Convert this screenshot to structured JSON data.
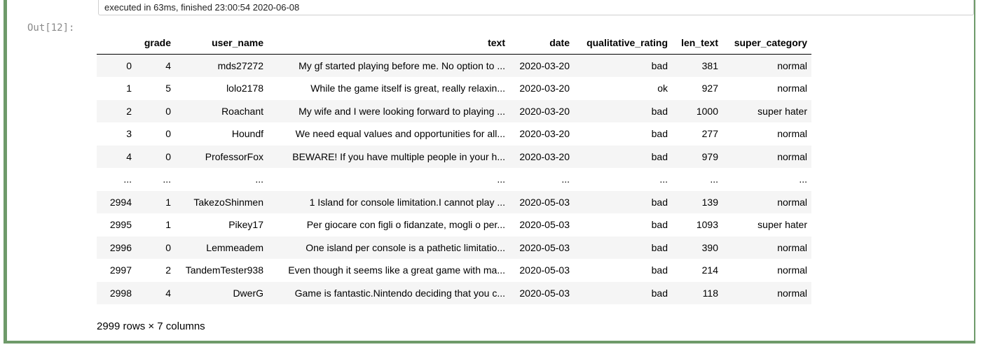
{
  "exec_status": "executed in 63ms, finished 23:00:54 2020-06-08",
  "out_prompt": "Out[12]:",
  "table": {
    "columns": [
      "grade",
      "user_name",
      "text",
      "date",
      "qualitative_rating",
      "len_text",
      "super_category"
    ],
    "rows": [
      [
        "0",
        "4",
        "mds27272",
        "My gf started playing before me. No option to ...",
        "2020-03-20",
        "bad",
        "381",
        "normal"
      ],
      [
        "1",
        "5",
        "lolo2178",
        "While the game itself is great, really relaxin...",
        "2020-03-20",
        "ok",
        "927",
        "normal"
      ],
      [
        "2",
        "0",
        "Roachant",
        "My wife and I were looking forward to playing ...",
        "2020-03-20",
        "bad",
        "1000",
        "super hater"
      ],
      [
        "3",
        "0",
        "Houndf",
        "We need equal values and opportunities for all...",
        "2020-03-20",
        "bad",
        "277",
        "normal"
      ],
      [
        "4",
        "0",
        "ProfessorFox",
        "BEWARE! If you have multiple people in your h...",
        "2020-03-20",
        "bad",
        "979",
        "normal"
      ],
      [
        "...",
        "...",
        "...",
        "...",
        "...",
        "...",
        "...",
        "..."
      ],
      [
        "2994",
        "1",
        "TakezoShinmen",
        "1 Island for console limitation.I cannot play ...",
        "2020-05-03",
        "bad",
        "139",
        "normal"
      ],
      [
        "2995",
        "1",
        "Pikey17",
        "Per giocare con figli o fidanzate, mogli o per...",
        "2020-05-03",
        "bad",
        "1093",
        "super hater"
      ],
      [
        "2996",
        "0",
        "Lemmeadem",
        "One island per console is a pathetic limitatio...",
        "2020-05-03",
        "bad",
        "390",
        "normal"
      ],
      [
        "2997",
        "2",
        "TandemTester938",
        "Even though it seems like a great game with ma...",
        "2020-05-03",
        "bad",
        "214",
        "normal"
      ],
      [
        "2998",
        "4",
        "DwerG",
        "Game is fantastic.Nintendo deciding that you c...",
        "2020-05-03",
        "bad",
        "118",
        "normal"
      ]
    ]
  },
  "dimensions_text": "2999 rows × 7 columns",
  "colors": {
    "cell_border": "#6e9a6a",
    "stripe": "#f5f5f5",
    "prompt": "#8a8a8a"
  }
}
